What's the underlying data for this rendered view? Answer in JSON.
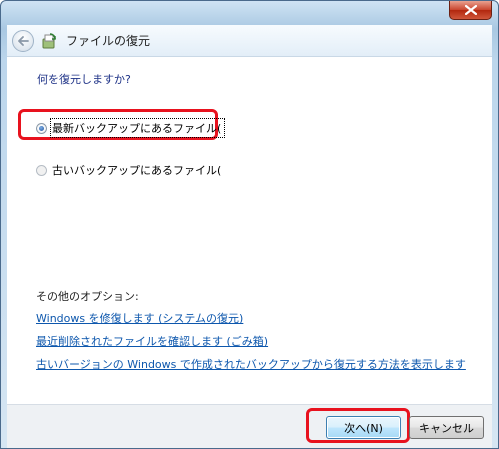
{
  "window": {
    "title": "ファイルの復元"
  },
  "content": {
    "question": "何を復元しますか?",
    "options": [
      {
        "label": "最新バックアップにあるファイル(",
        "checked": true
      },
      {
        "label": "古いバックアップにあるファイル(",
        "checked": false
      }
    ],
    "other_options_heading": "その他のオプション:",
    "links": [
      "Windows を修復します (システムの復元)",
      "最近削除されたファイルを確認します (ごみ箱)",
      "古いバージョンの Windows で作成されたバックアップから復元する方法を表示します"
    ]
  },
  "footer": {
    "next_label": "次へ(N)",
    "cancel_label": "キャンセル"
  },
  "colors": {
    "highlight": "#e8121e",
    "link": "#0d57ad",
    "question_text": "#1e3287"
  },
  "icons": [
    "close-icon",
    "back-arrow-icon",
    "restore-files-icon"
  ]
}
